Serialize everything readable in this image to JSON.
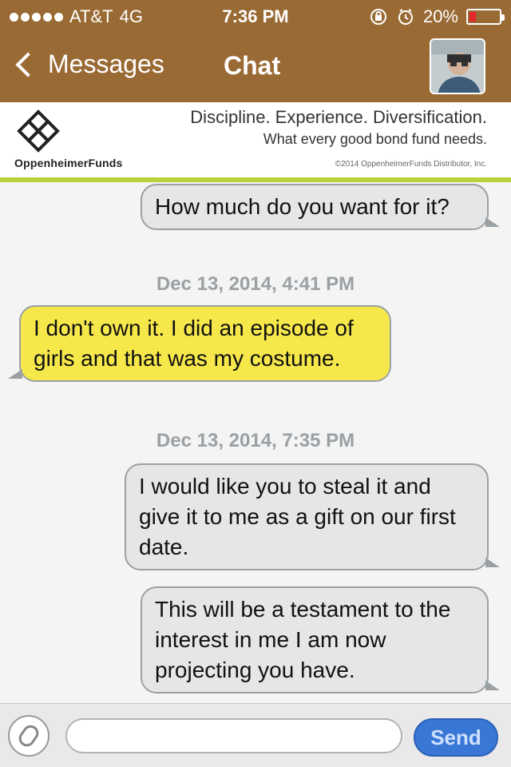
{
  "status_bar": {
    "carrier": "AT&T",
    "network": "4G",
    "time": "7:36 PM",
    "battery_label": "20%",
    "icons": [
      "rotation-lock-icon",
      "alarm-icon"
    ]
  },
  "nav": {
    "back_label": "Messages",
    "title": "Chat",
    "avatar_alt": "contact avatar"
  },
  "ad": {
    "brand": "OppenheimerFunds",
    "headline": "Discipline. Experience. Diversification.",
    "subline": "What every good bond fund needs.",
    "legal": "©2014 OppenheimerFunds Distributor, Inc."
  },
  "chat": {
    "messages": [
      {
        "side": "right",
        "text": "How much do you want for it?"
      },
      {
        "timestamp": "Dec 13, 2014, 4:41 PM"
      },
      {
        "side": "left",
        "text": "I don't own it. I did an episode of girls and that was my costume."
      },
      {
        "timestamp": "Dec 13, 2014, 7:35 PM"
      },
      {
        "side": "right",
        "text": "I would like you to steal it and give it to me as a gift on our first date."
      },
      {
        "side": "right",
        "text": "This will be a testament to the interest in me I am now projecting you have."
      }
    ]
  },
  "composer": {
    "placeholder": "",
    "send_label": "Send"
  },
  "colors": {
    "header_brown": "#9a6a34",
    "my_bubble_gray": "#e6e6e6",
    "their_bubble_yellow": "#f6e84b",
    "ad_green": "#b7d23d",
    "send_blue": "#3977d6"
  }
}
